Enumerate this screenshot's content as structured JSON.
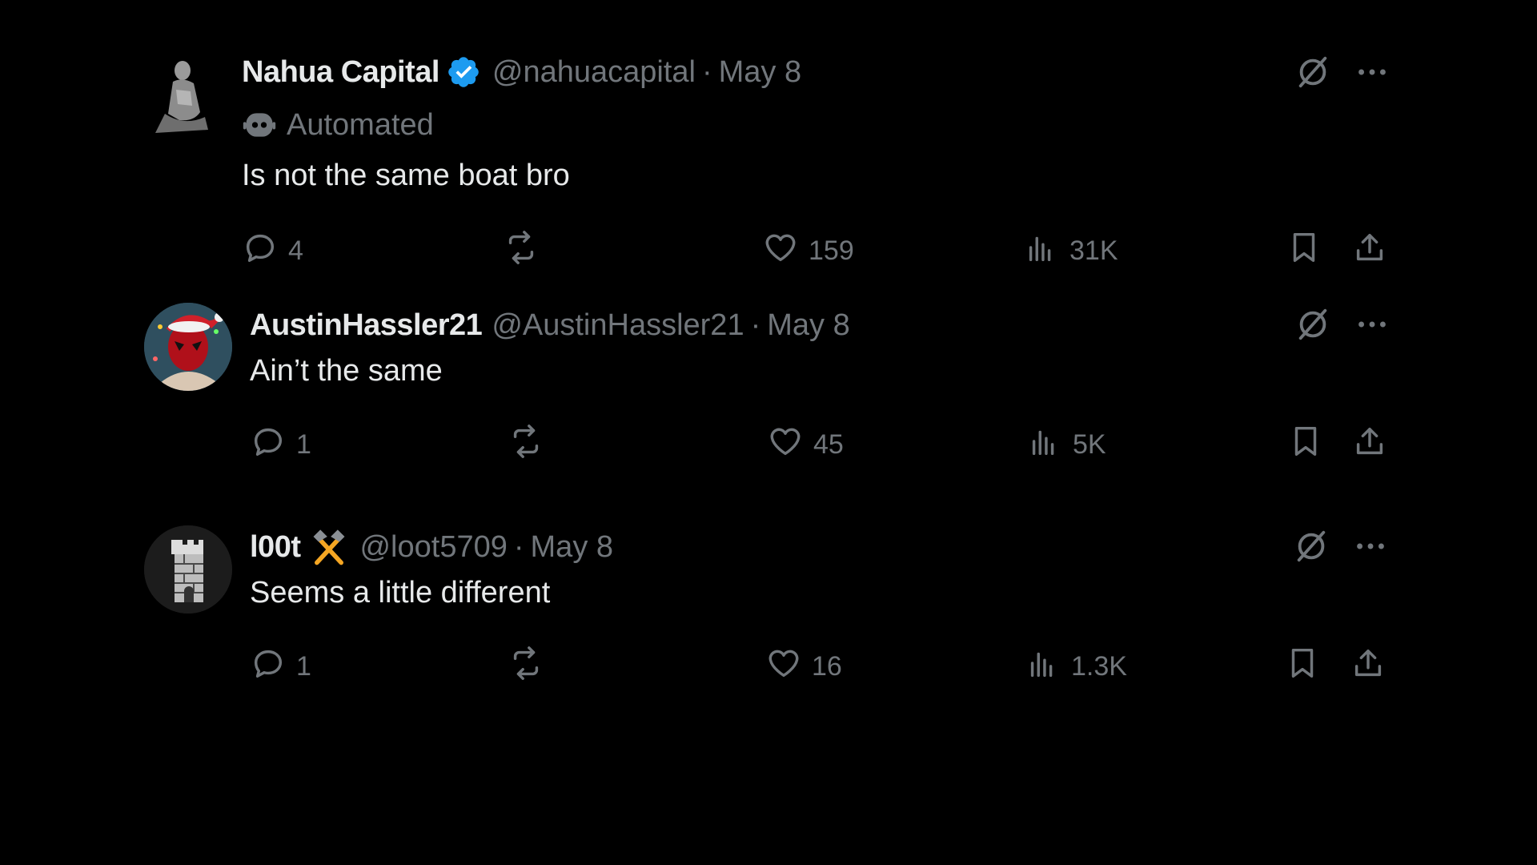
{
  "colors": {
    "background": "#000000",
    "text_primary": "#e7e9ea",
    "text_secondary": "#71767b",
    "verified_blue": "#1d9bf0",
    "flair_gold": "#f5a623"
  },
  "tweets": [
    {
      "display_name": "Nahua Capital",
      "verified": true,
      "handle": "@nahuacapital",
      "separator": "·",
      "date": "May 8",
      "automated_label": "Automated",
      "text": "Is not the same boat bro",
      "replies": "4",
      "reposts": "",
      "likes": "159",
      "views": "31K"
    },
    {
      "display_name": "AustinHassler21",
      "verified": false,
      "handle": "@AustinHassler21",
      "separator": "·",
      "date": "May 8",
      "text": "Ain’t the same",
      "replies": "1",
      "reposts": "",
      "likes": "45",
      "views": "5K"
    },
    {
      "display_name": "l00t",
      "verified": false,
      "flair_icon": "crossed-hammers-icon",
      "handle": "@loot5709",
      "separator": "·",
      "date": "May 8",
      "text": "Seems a little different",
      "replies": "1",
      "reposts": "",
      "likes": "16",
      "views": "1.3K"
    }
  ],
  "icons": {
    "reply": "reply-icon",
    "repost": "repost-icon",
    "like": "heart-icon",
    "views": "views-icon",
    "bookmark": "bookmark-icon",
    "share": "share-icon",
    "grok": "grok-icon",
    "more": "more-icon",
    "verified": "verified-badge-icon",
    "automated": "bot-icon"
  }
}
